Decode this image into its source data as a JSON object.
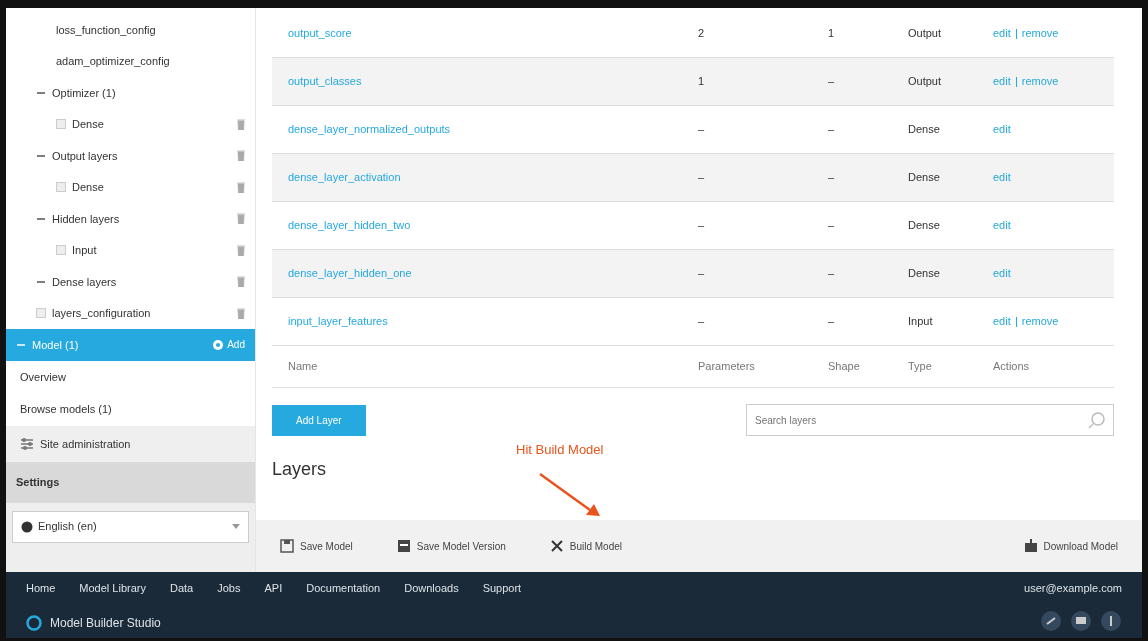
{
  "navbar": {
    "brand": "Model Builder Studio",
    "links": [
      "Home",
      "Model Library",
      "Data",
      "Jobs",
      "API",
      "Documentation",
      "Downloads",
      "Support"
    ],
    "user": "user@example.com"
  },
  "sidebar": {
    "tree": [
      {
        "label": "Model (1)",
        "selected": true,
        "expanded": true,
        "action": "Add",
        "children": [
          {
            "label": "Optimizer (1)",
            "selected": false,
            "removable": false,
            "expanded": true,
            "children": [
              {
                "label": "loss_function_config",
                "selected": false,
                "removable": false
              },
              {
                "label": "adam_optimizer_config",
                "selected": false,
                "removable": false
              }
            ]
          },
          {
            "label": "Output layers",
            "selected": false,
            "removable": true,
            "expanded": true,
            "children": [
              {
                "label": "Dense",
                "selected": false,
                "removable": true
              }
            ]
          },
          {
            "label": "Hidden layers",
            "selected": false,
            "removable": true,
            "expanded": true,
            "children": [
              {
                "label": "Dense",
                "selected": false,
                "removable": true
              }
            ]
          },
          {
            "label": "Dense layers",
            "selected": false,
            "removable": true,
            "expanded": true,
            "children": [
              {
                "label": "Input",
                "selected": false,
                "removable": true
              }
            ]
          },
          {
            "label": "layers_configuration",
            "selected": false,
            "removable": true
          }
        ]
      }
    ],
    "links": [
      "Overview",
      "Browse models (1)"
    ],
    "admin_link": "Site administration",
    "settings_title": "Settings",
    "language": "English (en)"
  },
  "table": {
    "rows": [
      {
        "name": "output_score",
        "parameters": "2",
        "shape": "1",
        "type": "Output",
        "actions": [
          "edit",
          "remove"
        ]
      },
      {
        "name": "output_classes",
        "parameters": "1",
        "shape": "–",
        "type": "Output",
        "actions": [
          "edit",
          "remove"
        ]
      },
      {
        "name": "dense_layer_normalized_outputs",
        "parameters": "–",
        "shape": "–",
        "type": "Dense",
        "actions": [
          "edit"
        ]
      },
      {
        "name": "dense_layer_activation",
        "parameters": "–",
        "shape": "–",
        "type": "Dense",
        "actions": [
          "edit"
        ]
      },
      {
        "name": "dense_layer_hidden_two",
        "parameters": "–",
        "shape": "–",
        "type": "Dense",
        "actions": [
          "edit"
        ]
      },
      {
        "name": "dense_layer_hidden_one",
        "parameters": "–",
        "shape": "–",
        "type": "Dense",
        "actions": [
          "edit"
        ]
      },
      {
        "name": "input_layer_features",
        "parameters": "–",
        "shape": "–",
        "type": "Input",
        "actions": [
          "edit",
          "remove"
        ]
      }
    ],
    "columns": [
      "Name",
      "Parameters",
      "Shape",
      "Type",
      "Actions"
    ]
  },
  "add_button": "Add Layer",
  "search": {
    "placeholder": "Search layers"
  },
  "annotation": "Hit Build Model",
  "heading": "Layers",
  "toolbar": {
    "buttons": [
      "Save Model",
      "Save Model Version",
      "Build Model"
    ],
    "right_button": "Download Model"
  }
}
